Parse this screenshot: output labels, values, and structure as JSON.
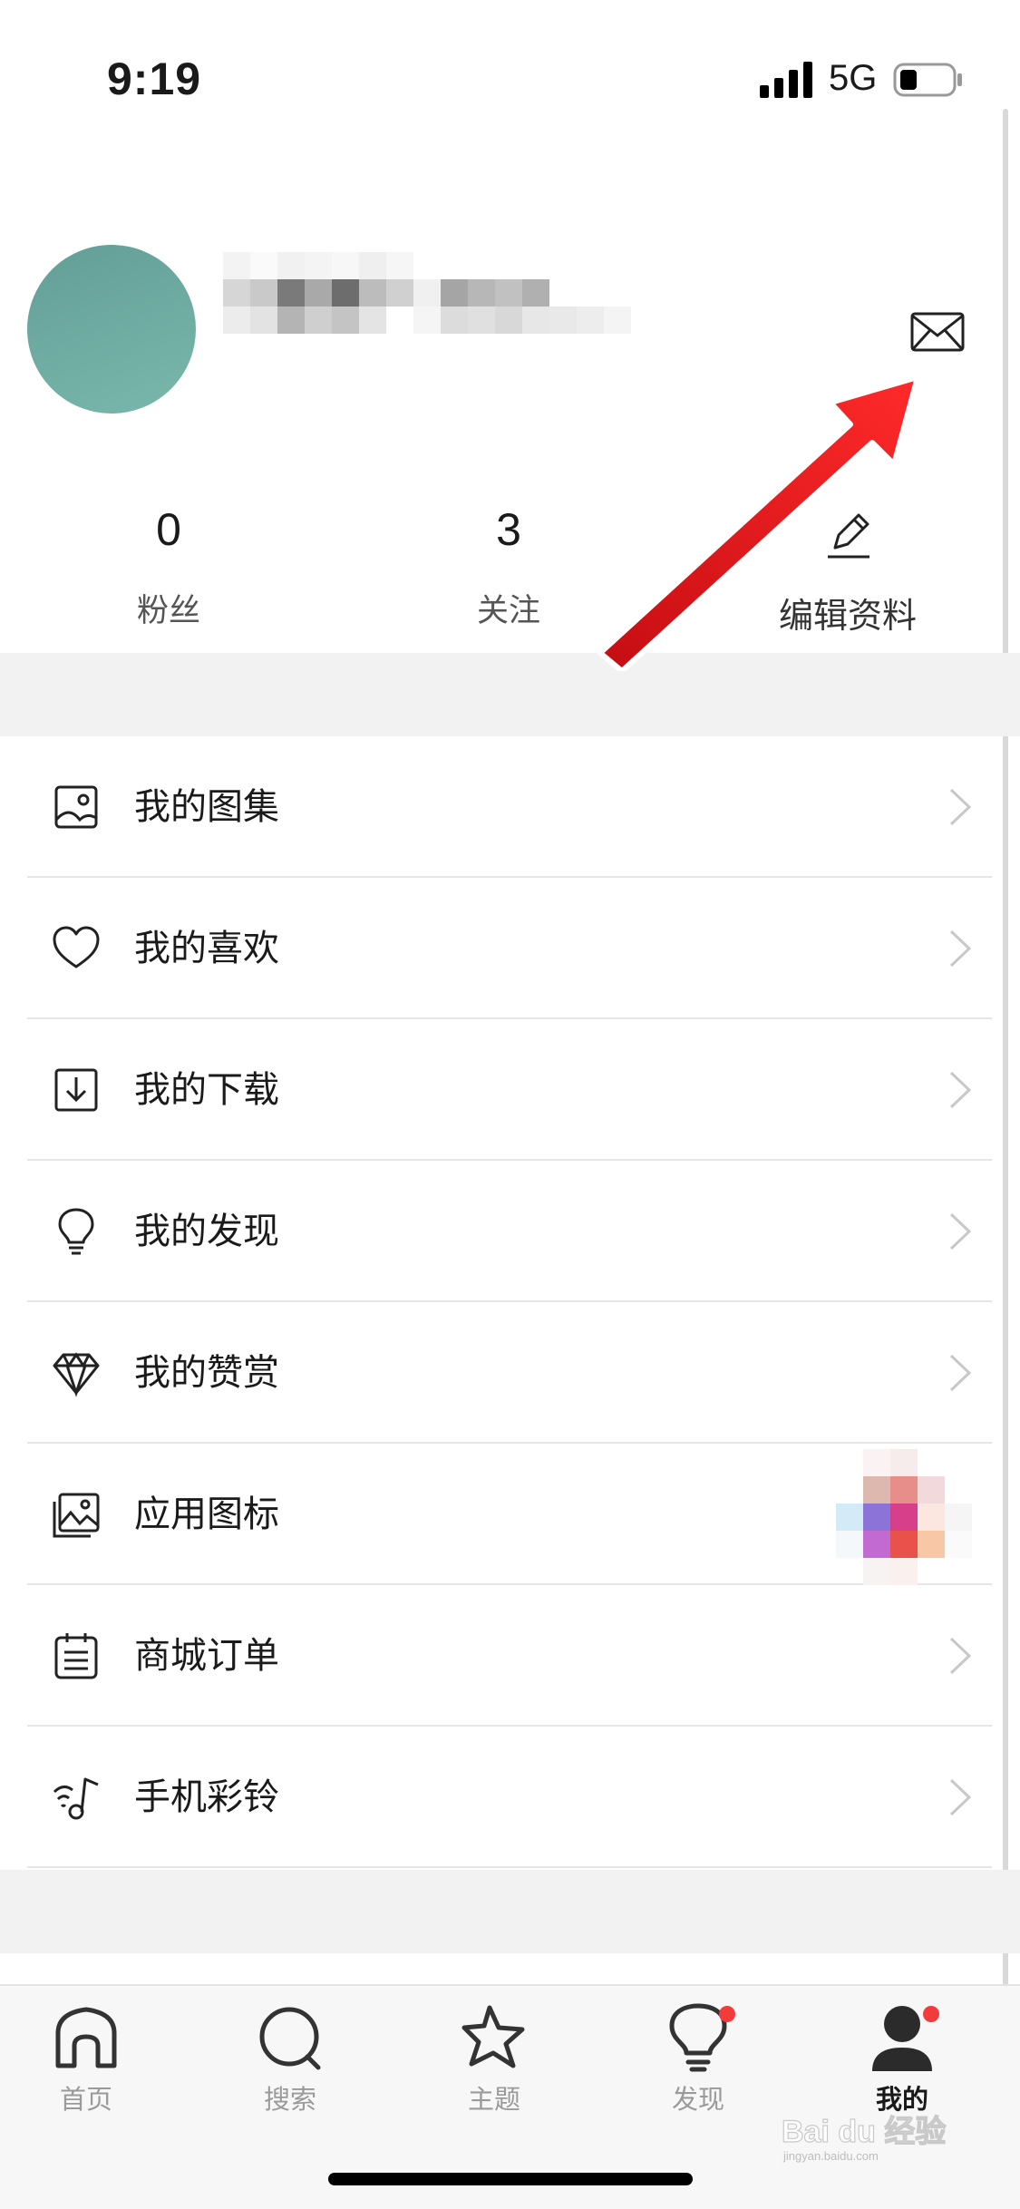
{
  "status_bar": {
    "time": "9:19",
    "network": "5G",
    "icons": [
      "signal-icon",
      "battery-icon"
    ]
  },
  "profile": {
    "avatar_color": "#6aa89f",
    "stats": [
      {
        "value": "0",
        "label": "粉丝"
      },
      {
        "value": "3",
        "label": "关注"
      }
    ],
    "edit_label": "编辑资料",
    "icons": [
      "mail-icon",
      "edit-pencil-icon"
    ]
  },
  "menu": {
    "items": [
      {
        "label": "我的图集",
        "icon": "album-icon"
      },
      {
        "label": "我的喜欢",
        "icon": "heart-icon"
      },
      {
        "label": "我的下载",
        "icon": "download-icon"
      },
      {
        "label": "我的发现",
        "icon": "lightbulb-icon"
      },
      {
        "label": "我的赞赏",
        "icon": "diamond-icon"
      },
      {
        "label": "应用图标",
        "icon": "image-stack-icon"
      },
      {
        "label": "商城订单",
        "icon": "order-calendar-icon"
      },
      {
        "label": "手机彩铃",
        "icon": "ringtone-icon"
      }
    ]
  },
  "tab_bar": {
    "tabs": [
      {
        "label": "首页",
        "icon": "home-icon",
        "active": false,
        "badge": false
      },
      {
        "label": "搜索",
        "icon": "search-icon",
        "active": false,
        "badge": false
      },
      {
        "label": "主题",
        "icon": "star-icon",
        "active": false,
        "badge": false
      },
      {
        "label": "发现",
        "icon": "lightbulb-icon",
        "active": false,
        "badge": true
      },
      {
        "label": "我的",
        "icon": "profile-icon",
        "active": true,
        "badge": true
      }
    ]
  },
  "colors": {
    "accent_red": "#f23c3c",
    "annotation_arrow": "#e8151b",
    "divider": "#e6e6e6",
    "band_gray": "#f2f2f2"
  },
  "watermark": {
    "brand": "Bai du 经验",
    "url": "jingyan.baidu.com"
  }
}
